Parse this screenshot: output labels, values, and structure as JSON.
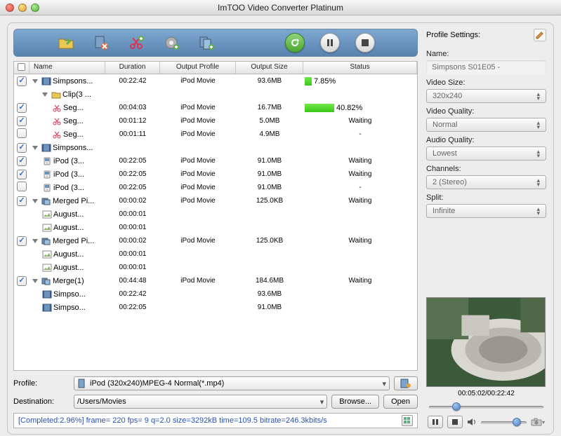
{
  "window_title": "ImTOO Video Converter Platinum",
  "columns": {
    "name": "Name",
    "duration": "Duration",
    "profile": "Output Profile",
    "size": "Output Size",
    "status": "Status"
  },
  "rows": [
    {
      "checked": true,
      "indent": 0,
      "expand": true,
      "icon": "film",
      "name": "Simpsons...",
      "duration": "00:22:42",
      "profile": "iPod Movie",
      "size": "93.6MB",
      "progress": 7.85,
      "status_text": "7.85%"
    },
    {
      "checked": null,
      "indent": 1,
      "expand": true,
      "icon": "folder",
      "name": "Clip(3 ...",
      "duration": "",
      "profile": "",
      "size": "",
      "status_text": ""
    },
    {
      "checked": true,
      "indent": 2,
      "icon": "scissors",
      "name": "Seg...",
      "duration": "00:04:03",
      "profile": "iPod Movie",
      "size": "16.7MB",
      "progress": 40.82,
      "pbar_w": 42,
      "status_text": "40.82%"
    },
    {
      "checked": true,
      "indent": 2,
      "icon": "scissors",
      "name": "Seg...",
      "duration": "00:01:12",
      "profile": "iPod Movie",
      "size": "5.0MB",
      "status_text": "Waiting"
    },
    {
      "checked": false,
      "indent": 2,
      "icon": "scissors",
      "name": "Seg...",
      "duration": "00:01:11",
      "profile": "iPod Movie",
      "size": "4.9MB",
      "status_text": "-"
    },
    {
      "checked": true,
      "indent": 0,
      "expand": true,
      "icon": "film",
      "name": "Simpsons...",
      "duration": "",
      "profile": "",
      "size": "",
      "status_text": ""
    },
    {
      "checked": true,
      "indent": 1,
      "icon": "ipod",
      "name": "iPod (3...",
      "duration": "00:22:05",
      "profile": "iPod Movie",
      "size": "91.0MB",
      "status_text": "Waiting"
    },
    {
      "checked": true,
      "indent": 1,
      "icon": "ipod",
      "name": "iPod (3...",
      "duration": "00:22:05",
      "profile": "iPod Movie",
      "size": "91.0MB",
      "status_text": "Waiting"
    },
    {
      "checked": false,
      "indent": 1,
      "icon": "ipod",
      "name": "iPod (3...",
      "duration": "00:22:05",
      "profile": "iPod Movie",
      "size": "91.0MB",
      "status_text": "-"
    },
    {
      "checked": true,
      "indent": 0,
      "expand": true,
      "icon": "merge",
      "name": "Merged Pi...",
      "duration": "00:00:02",
      "profile": "iPod Movie",
      "size": "125.0KB",
      "status_text": "Waiting"
    },
    {
      "checked": null,
      "indent": 1,
      "icon": "pic",
      "name": "August...",
      "duration": "00:00:01",
      "profile": "",
      "size": "",
      "status_text": ""
    },
    {
      "checked": null,
      "indent": 1,
      "icon": "pic",
      "name": "August...",
      "duration": "00:00:01",
      "profile": "",
      "size": "",
      "status_text": ""
    },
    {
      "checked": true,
      "indent": 0,
      "expand": true,
      "icon": "merge",
      "name": "Merged Pi...",
      "duration": "00:00:02",
      "profile": "iPod Movie",
      "size": "125.0KB",
      "status_text": "Waiting"
    },
    {
      "checked": null,
      "indent": 1,
      "icon": "pic",
      "name": "August...",
      "duration": "00:00:01",
      "profile": "",
      "size": "",
      "status_text": ""
    },
    {
      "checked": null,
      "indent": 1,
      "icon": "pic",
      "name": "August...",
      "duration": "00:00:01",
      "profile": "",
      "size": "",
      "status_text": ""
    },
    {
      "checked": true,
      "indent": 0,
      "expand": true,
      "icon": "merge2",
      "name": "Merge(1)",
      "duration": "00:44:48",
      "profile": "iPod Movie",
      "size": "184.6MB",
      "status_text": "Waiting"
    },
    {
      "checked": null,
      "indent": 1,
      "icon": "film",
      "name": "Simpso...",
      "duration": "00:22:42",
      "profile": "",
      "size": "93.6MB",
      "status_text": ""
    },
    {
      "checked": null,
      "indent": 1,
      "icon": "film",
      "name": "Simpso...",
      "duration": "00:22:05",
      "profile": "",
      "size": "91.0MB",
      "status_text": ""
    }
  ],
  "profile_label": "Profile:",
  "profile_value": "iPod (320x240)MPEG-4 Normal(*.mp4)",
  "dest_label": "Destination:",
  "dest_value": "/Users/Movies",
  "browse": "Browse...",
  "open": "Open",
  "status_line": "[Completed:2.96%] frame=  220 fps=  9 q=2.0 size=3292kB time=109.5 bitrate=246.3kbits/s",
  "side": {
    "title": "Profile Settings:",
    "name_label": "Name:",
    "name_value": "Simpsons S01E05 -",
    "vsize_label": "Video Size:",
    "vsize_value": "320x240",
    "vq_label": "Video Quality:",
    "vq_value": "Normal",
    "aq_label": "Audio Quality:",
    "aq_value": "Lowest",
    "ch_label": "Channels:",
    "ch_value": "2 (Stereo)",
    "split_label": "Split:",
    "split_value": "Infinite"
  },
  "preview_time": "00:05:02/00:22:42"
}
